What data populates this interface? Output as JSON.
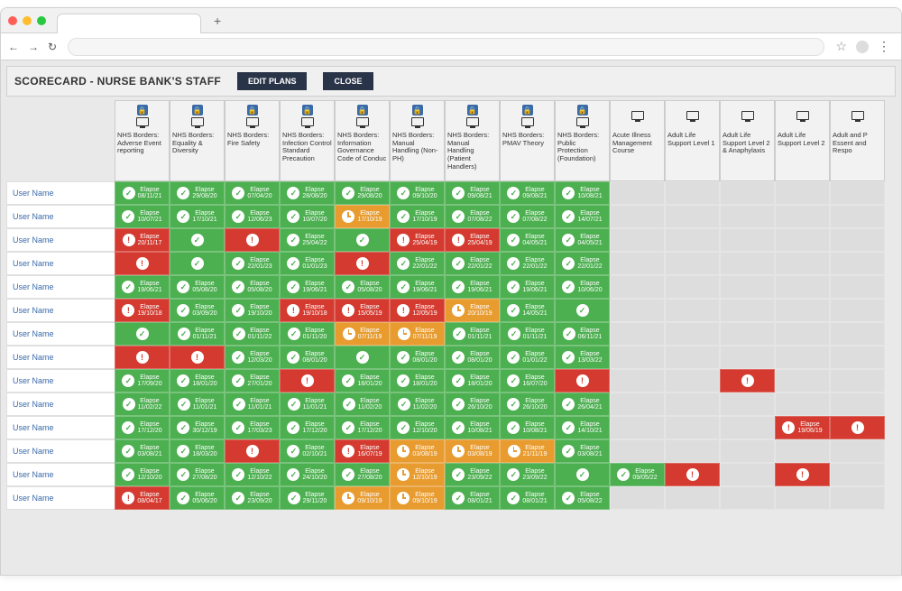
{
  "chrome": {
    "new_tab": "+",
    "back": "←",
    "forward": "→",
    "reload": "↻",
    "star": "☆",
    "menu": "⋮"
  },
  "header": {
    "title": "SCORECARD - NURSE BANK'S STAFF",
    "edit_plans": "EDIT PLANS",
    "close": "CLOSE"
  },
  "grid": {
    "elapse_label": "Elapse",
    "columns": [
      {
        "label": "NHS Borders: Adverse Event reporting",
        "locked": true
      },
      {
        "label": "NHS Borders: Equality & Diversity",
        "locked": true
      },
      {
        "label": "NHS Borders: Fire Safety",
        "locked": true
      },
      {
        "label": "NHS Borders: Infection Control Standard Precaution",
        "locked": true
      },
      {
        "label": "NHS Borders: Information Governance Code of Conduc",
        "locked": true
      },
      {
        "label": "NHS Borders: Manual Handling (Non-PH)",
        "locked": true
      },
      {
        "label": "NHS Borders: Manual Handling (Patient Handlers)",
        "locked": true
      },
      {
        "label": "NHS Borders: PMAV Theory",
        "locked": true
      },
      {
        "label": "NHS Borders: Public Protection (Foundation)",
        "locked": true
      },
      {
        "label": "Acute Illness Management Course",
        "locked": false
      },
      {
        "label": "Adult Life Support Level 1",
        "locked": false
      },
      {
        "label": "Adult Life Support Level 2 & Anaphylaxis",
        "locked": false
      },
      {
        "label": "Adult Life Support Level 2",
        "locked": false
      },
      {
        "label": "Adult and P Essent and Respo",
        "locked": false
      }
    ],
    "rows": [
      {
        "user": "User Name",
        "cells": [
          {
            "t": "ok",
            "d": "08/11/21"
          },
          {
            "t": "ok",
            "d": "29/08/20"
          },
          {
            "t": "ok",
            "d": "07/04/20"
          },
          {
            "t": "ok",
            "d": "28/08/20"
          },
          {
            "t": "ok",
            "d": "29/08/20"
          },
          {
            "t": "ok",
            "d": "09/10/20"
          },
          {
            "t": "ok",
            "d": "09/08/21"
          },
          {
            "t": "ok",
            "d": "09/08/21"
          },
          {
            "t": "ok",
            "d": "10/08/21"
          },
          {
            "t": "empty"
          },
          {
            "t": "empty"
          },
          {
            "t": "empty"
          },
          {
            "t": "empty"
          },
          {
            "t": "empty"
          }
        ]
      },
      {
        "user": "User Name",
        "cells": [
          {
            "t": "ok",
            "d": "10/07/21"
          },
          {
            "t": "ok",
            "d": "17/10/21"
          },
          {
            "t": "ok",
            "d": "12/06/23"
          },
          {
            "t": "ok",
            "d": "10/07/20"
          },
          {
            "t": "clock",
            "d": "17/10/19"
          },
          {
            "t": "ok",
            "d": "17/10/19"
          },
          {
            "t": "ok",
            "d": "07/08/22"
          },
          {
            "t": "ok",
            "d": "07/08/22"
          },
          {
            "t": "ok",
            "d": "14/07/21"
          },
          {
            "t": "empty"
          },
          {
            "t": "empty"
          },
          {
            "t": "empty"
          },
          {
            "t": "empty"
          },
          {
            "t": "empty"
          }
        ]
      },
      {
        "user": "User Name",
        "cells": [
          {
            "t": "alert",
            "d": "20/11/17"
          },
          {
            "t": "ok"
          },
          {
            "t": "alert"
          },
          {
            "t": "ok",
            "d": "25/04/22"
          },
          {
            "t": "ok"
          },
          {
            "t": "alert",
            "d": "25/04/19"
          },
          {
            "t": "alert",
            "d": "25/04/19"
          },
          {
            "t": "ok",
            "d": "04/05/21"
          },
          {
            "t": "ok",
            "d": "04/05/21"
          },
          {
            "t": "empty"
          },
          {
            "t": "empty"
          },
          {
            "t": "empty"
          },
          {
            "t": "empty"
          },
          {
            "t": "empty"
          }
        ]
      },
      {
        "user": "User Name",
        "cells": [
          {
            "t": "alert"
          },
          {
            "t": "ok"
          },
          {
            "t": "ok",
            "d": "22/01/23"
          },
          {
            "t": "ok",
            "d": "01/01/23"
          },
          {
            "t": "alert"
          },
          {
            "t": "ok",
            "d": "22/01/22"
          },
          {
            "t": "ok",
            "d": "22/01/22"
          },
          {
            "t": "ok",
            "d": "22/01/22"
          },
          {
            "t": "ok",
            "d": "22/01/22"
          },
          {
            "t": "empty"
          },
          {
            "t": "empty"
          },
          {
            "t": "empty"
          },
          {
            "t": "empty"
          },
          {
            "t": "empty"
          }
        ]
      },
      {
        "user": "User Name",
        "cells": [
          {
            "t": "ok",
            "d": "19/06/21"
          },
          {
            "t": "ok",
            "d": "05/08/20"
          },
          {
            "t": "ok",
            "d": "05/08/20"
          },
          {
            "t": "ok",
            "d": "19/06/21"
          },
          {
            "t": "ok",
            "d": "05/08/20"
          },
          {
            "t": "ok",
            "d": "19/06/21"
          },
          {
            "t": "ok",
            "d": "19/06/21"
          },
          {
            "t": "ok",
            "d": "19/06/21"
          },
          {
            "t": "ok",
            "d": "10/06/20"
          },
          {
            "t": "empty"
          },
          {
            "t": "empty"
          },
          {
            "t": "empty"
          },
          {
            "t": "empty"
          },
          {
            "t": "empty"
          }
        ]
      },
      {
        "user": "User Name",
        "cells": [
          {
            "t": "alert",
            "d": "19/10/18"
          },
          {
            "t": "ok",
            "d": "03/09/20"
          },
          {
            "t": "ok",
            "d": "19/10/20"
          },
          {
            "t": "alert",
            "d": "19/10/18"
          },
          {
            "t": "alert",
            "d": "15/05/19"
          },
          {
            "t": "alert",
            "d": "12/05/19"
          },
          {
            "t": "clock",
            "d": "20/10/19"
          },
          {
            "t": "ok",
            "d": "14/05/21"
          },
          {
            "t": "ok"
          },
          {
            "t": "empty"
          },
          {
            "t": "empty"
          },
          {
            "t": "empty"
          },
          {
            "t": "empty"
          },
          {
            "t": "empty"
          }
        ]
      },
      {
        "user": "User Name",
        "cells": [
          {
            "t": "ok"
          },
          {
            "t": "ok",
            "d": "01/11/21"
          },
          {
            "t": "ok",
            "d": "01/11/22"
          },
          {
            "t": "ok",
            "d": "01/11/20"
          },
          {
            "t": "clock",
            "d": "07/11/19"
          },
          {
            "t": "clock",
            "d": "07/11/19"
          },
          {
            "t": "ok",
            "d": "01/11/21"
          },
          {
            "t": "ok",
            "d": "01/11/21"
          },
          {
            "t": "ok",
            "d": "06/11/21"
          },
          {
            "t": "empty"
          },
          {
            "t": "empty"
          },
          {
            "t": "empty"
          },
          {
            "t": "empty"
          },
          {
            "t": "empty"
          }
        ]
      },
      {
        "user": "User Name",
        "cells": [
          {
            "t": "alert"
          },
          {
            "t": "alert"
          },
          {
            "t": "ok",
            "d": "12/03/20"
          },
          {
            "t": "ok",
            "d": "08/01/20"
          },
          {
            "t": "ok"
          },
          {
            "t": "ok",
            "d": "08/01/20"
          },
          {
            "t": "ok",
            "d": "08/01/20"
          },
          {
            "t": "ok",
            "d": "01/01/22"
          },
          {
            "t": "ok",
            "d": "13/03/22"
          },
          {
            "t": "empty"
          },
          {
            "t": "empty"
          },
          {
            "t": "empty"
          },
          {
            "t": "empty"
          },
          {
            "t": "empty"
          }
        ]
      },
      {
        "user": "User Name",
        "cells": [
          {
            "t": "ok",
            "d": "17/09/20"
          },
          {
            "t": "ok",
            "d": "18/01/20"
          },
          {
            "t": "ok",
            "d": "27/01/20"
          },
          {
            "t": "alert"
          },
          {
            "t": "ok",
            "d": "18/01/20"
          },
          {
            "t": "ok",
            "d": "18/01/20"
          },
          {
            "t": "ok",
            "d": "18/01/20"
          },
          {
            "t": "ok",
            "d": "16/07/20"
          },
          {
            "t": "alert"
          },
          {
            "t": "empty"
          },
          {
            "t": "empty"
          },
          {
            "t": "alert"
          },
          {
            "t": "empty"
          },
          {
            "t": "empty"
          }
        ]
      },
      {
        "user": "User Name",
        "cells": [
          {
            "t": "ok",
            "d": "11/02/22"
          },
          {
            "t": "ok",
            "d": "11/01/21"
          },
          {
            "t": "ok",
            "d": "11/01/21"
          },
          {
            "t": "ok",
            "d": "11/01/21"
          },
          {
            "t": "ok",
            "d": "11/02/20"
          },
          {
            "t": "ok",
            "d": "11/02/20"
          },
          {
            "t": "ok",
            "d": "26/10/20"
          },
          {
            "t": "ok",
            "d": "26/10/20"
          },
          {
            "t": "ok",
            "d": "26/04/21"
          },
          {
            "t": "empty"
          },
          {
            "t": "empty"
          },
          {
            "t": "empty"
          },
          {
            "t": "empty"
          },
          {
            "t": "empty"
          }
        ]
      },
      {
        "user": "User Name",
        "cells": [
          {
            "t": "ok",
            "d": "17/12/20"
          },
          {
            "t": "ok",
            "d": "30/12/19"
          },
          {
            "t": "ok",
            "d": "17/03/23"
          },
          {
            "t": "ok",
            "d": "17/12/20"
          },
          {
            "t": "ok",
            "d": "17/12/20"
          },
          {
            "t": "ok",
            "d": "12/10/20"
          },
          {
            "t": "ok",
            "d": "10/08/21"
          },
          {
            "t": "ok",
            "d": "10/08/21"
          },
          {
            "t": "ok",
            "d": "14/10/21"
          },
          {
            "t": "empty"
          },
          {
            "t": "empty"
          },
          {
            "t": "empty"
          },
          {
            "t": "alert",
            "d": "19/06/19"
          },
          {
            "t": "alert"
          }
        ]
      },
      {
        "user": "User Name",
        "cells": [
          {
            "t": "ok",
            "d": "03/08/21"
          },
          {
            "t": "ok",
            "d": "18/03/20"
          },
          {
            "t": "alert"
          },
          {
            "t": "ok",
            "d": "02/10/21"
          },
          {
            "t": "alert",
            "d": "16/07/19"
          },
          {
            "t": "clock",
            "d": "03/08/19"
          },
          {
            "t": "clock",
            "d": "03/08/19"
          },
          {
            "t": "clock",
            "d": "21/11/19"
          },
          {
            "t": "ok",
            "d": "03/08/21"
          },
          {
            "t": "empty"
          },
          {
            "t": "empty"
          },
          {
            "t": "empty"
          },
          {
            "t": "empty"
          },
          {
            "t": "empty"
          }
        ]
      },
      {
        "user": "User Name",
        "cells": [
          {
            "t": "ok",
            "d": "12/10/20"
          },
          {
            "t": "ok",
            "d": "27/08/20"
          },
          {
            "t": "ok",
            "d": "12/10/22"
          },
          {
            "t": "ok",
            "d": "24/10/20"
          },
          {
            "t": "ok",
            "d": "27/08/20"
          },
          {
            "t": "clock",
            "d": "12/10/19"
          },
          {
            "t": "ok",
            "d": "23/09/22"
          },
          {
            "t": "ok",
            "d": "23/09/22"
          },
          {
            "t": "ok"
          },
          {
            "t": "ok",
            "d": "09/05/22"
          },
          {
            "t": "alert"
          },
          {
            "t": "empty"
          },
          {
            "t": "alert"
          },
          {
            "t": "empty"
          }
        ]
      },
      {
        "user": "User Name",
        "cells": [
          {
            "t": "alert",
            "d": "08/04/17"
          },
          {
            "t": "ok",
            "d": "05/06/20"
          },
          {
            "t": "ok",
            "d": "23/09/20"
          },
          {
            "t": "ok",
            "d": "29/11/20"
          },
          {
            "t": "clock",
            "d": "09/10/19"
          },
          {
            "t": "clock",
            "d": "09/10/19"
          },
          {
            "t": "ok",
            "d": "08/01/21"
          },
          {
            "t": "ok",
            "d": "08/01/21"
          },
          {
            "t": "ok",
            "d": "05/08/22"
          },
          {
            "t": "empty"
          },
          {
            "t": "empty"
          },
          {
            "t": "empty"
          },
          {
            "t": "empty"
          },
          {
            "t": "empty"
          }
        ]
      }
    ]
  }
}
